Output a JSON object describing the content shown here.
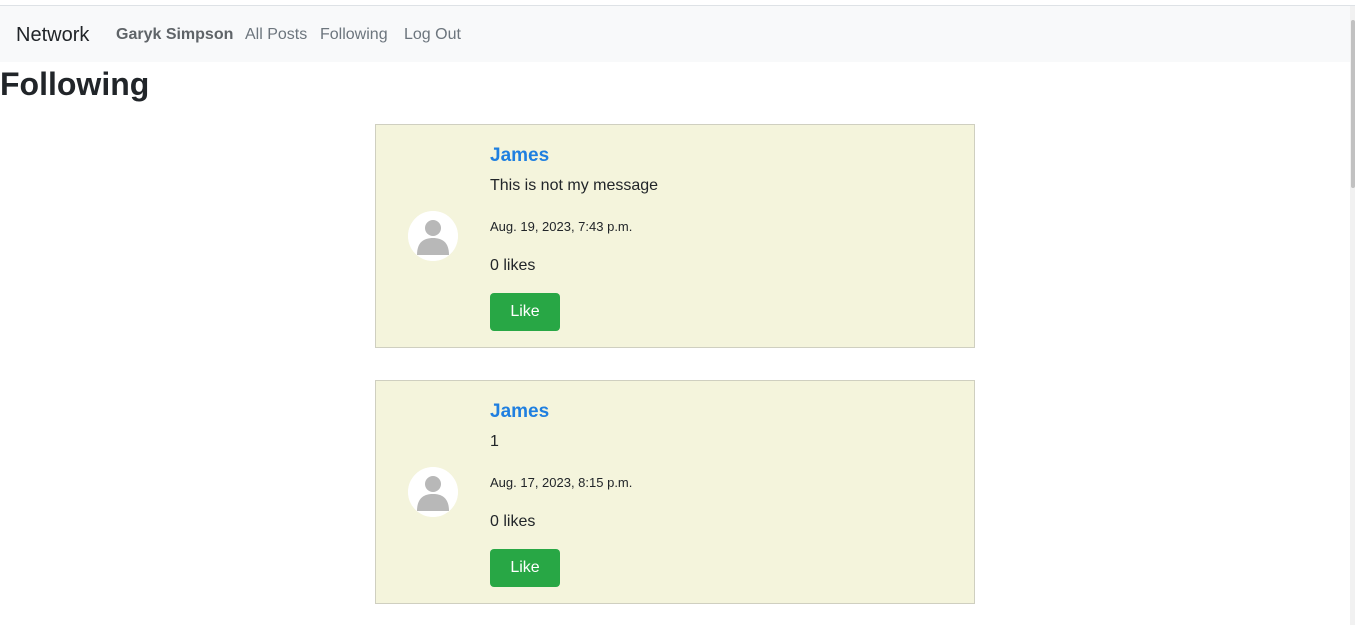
{
  "navbar": {
    "brand": "Network",
    "user": "Garyk Simpson",
    "all_posts": "All Posts",
    "following": "Following",
    "logout": "Log Out"
  },
  "page": {
    "title": "Following"
  },
  "posts": [
    {
      "author": "James",
      "content": "This is not my message",
      "timestamp": "Aug. 19, 2023, 7:43 p.m.",
      "likes": "0 likes",
      "like_label": "Like"
    },
    {
      "author": "James",
      "content": "1",
      "timestamp": "Aug. 17, 2023, 8:15 p.m.",
      "likes": "0 likes",
      "like_label": "Like"
    }
  ],
  "colors": {
    "navbar_bg": "#f8f9fa",
    "post_bg": "#f4f4dc",
    "author_link": "#1f7fe0",
    "like_button": "#28a745",
    "avatar_silhouette": "#b8b8b8"
  },
  "icons": {
    "avatar": "user-avatar-icon"
  }
}
